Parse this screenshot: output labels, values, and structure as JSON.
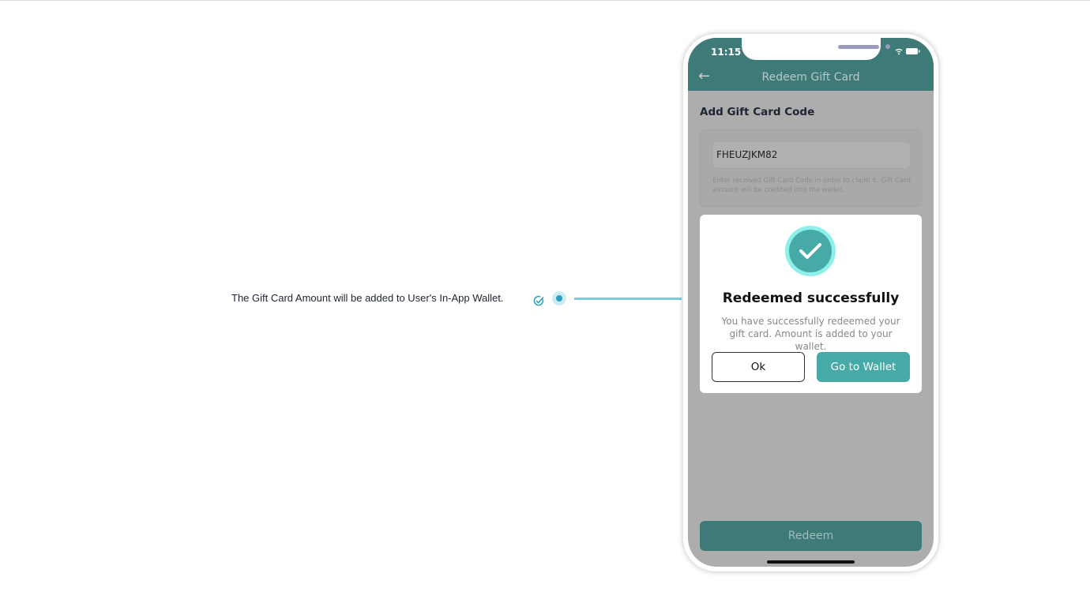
{
  "annotation": {
    "text": "The Gift Card Amount will be added to User's In-App Wallet.",
    "accent": "#2a9ec4"
  },
  "phone": {
    "status": {
      "time": "11:15"
    },
    "header": {
      "title": "Redeem Gift Card",
      "back": "←"
    },
    "section_title": "Add Gift Card Code",
    "code_input": {
      "value": "FHEUZJKM82"
    },
    "hint": "Enter received Gift Card Code in order to claim it. Gift Card amount will be credited into the wallet.",
    "modal": {
      "title": "Redeemed successfully",
      "message": "You have successfully redeemed your gift card. Amount is added to your wallet.",
      "ok_label": "Ok",
      "wallet_label": "Go to Wallet"
    },
    "redeem_label": "Redeem",
    "colors": {
      "primary": "#3e7b78",
      "accent": "#46aaa6"
    }
  }
}
